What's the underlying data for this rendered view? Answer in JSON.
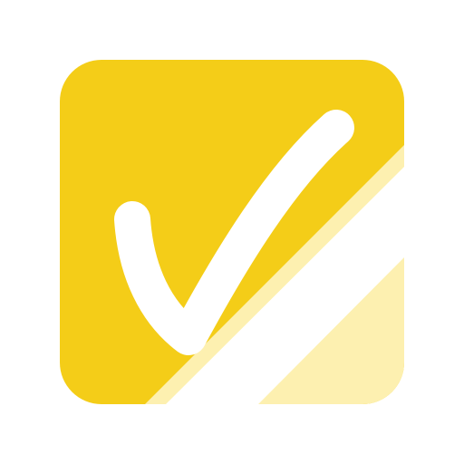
{
  "icon": {
    "name": "checkmark-icon",
    "colors": {
      "background": "#ffffff",
      "tile": "#f4cd18",
      "stripe_light": "#fdf0b0",
      "stripe_solid": "#ffffff",
      "checkmark": "#ffffff"
    }
  }
}
